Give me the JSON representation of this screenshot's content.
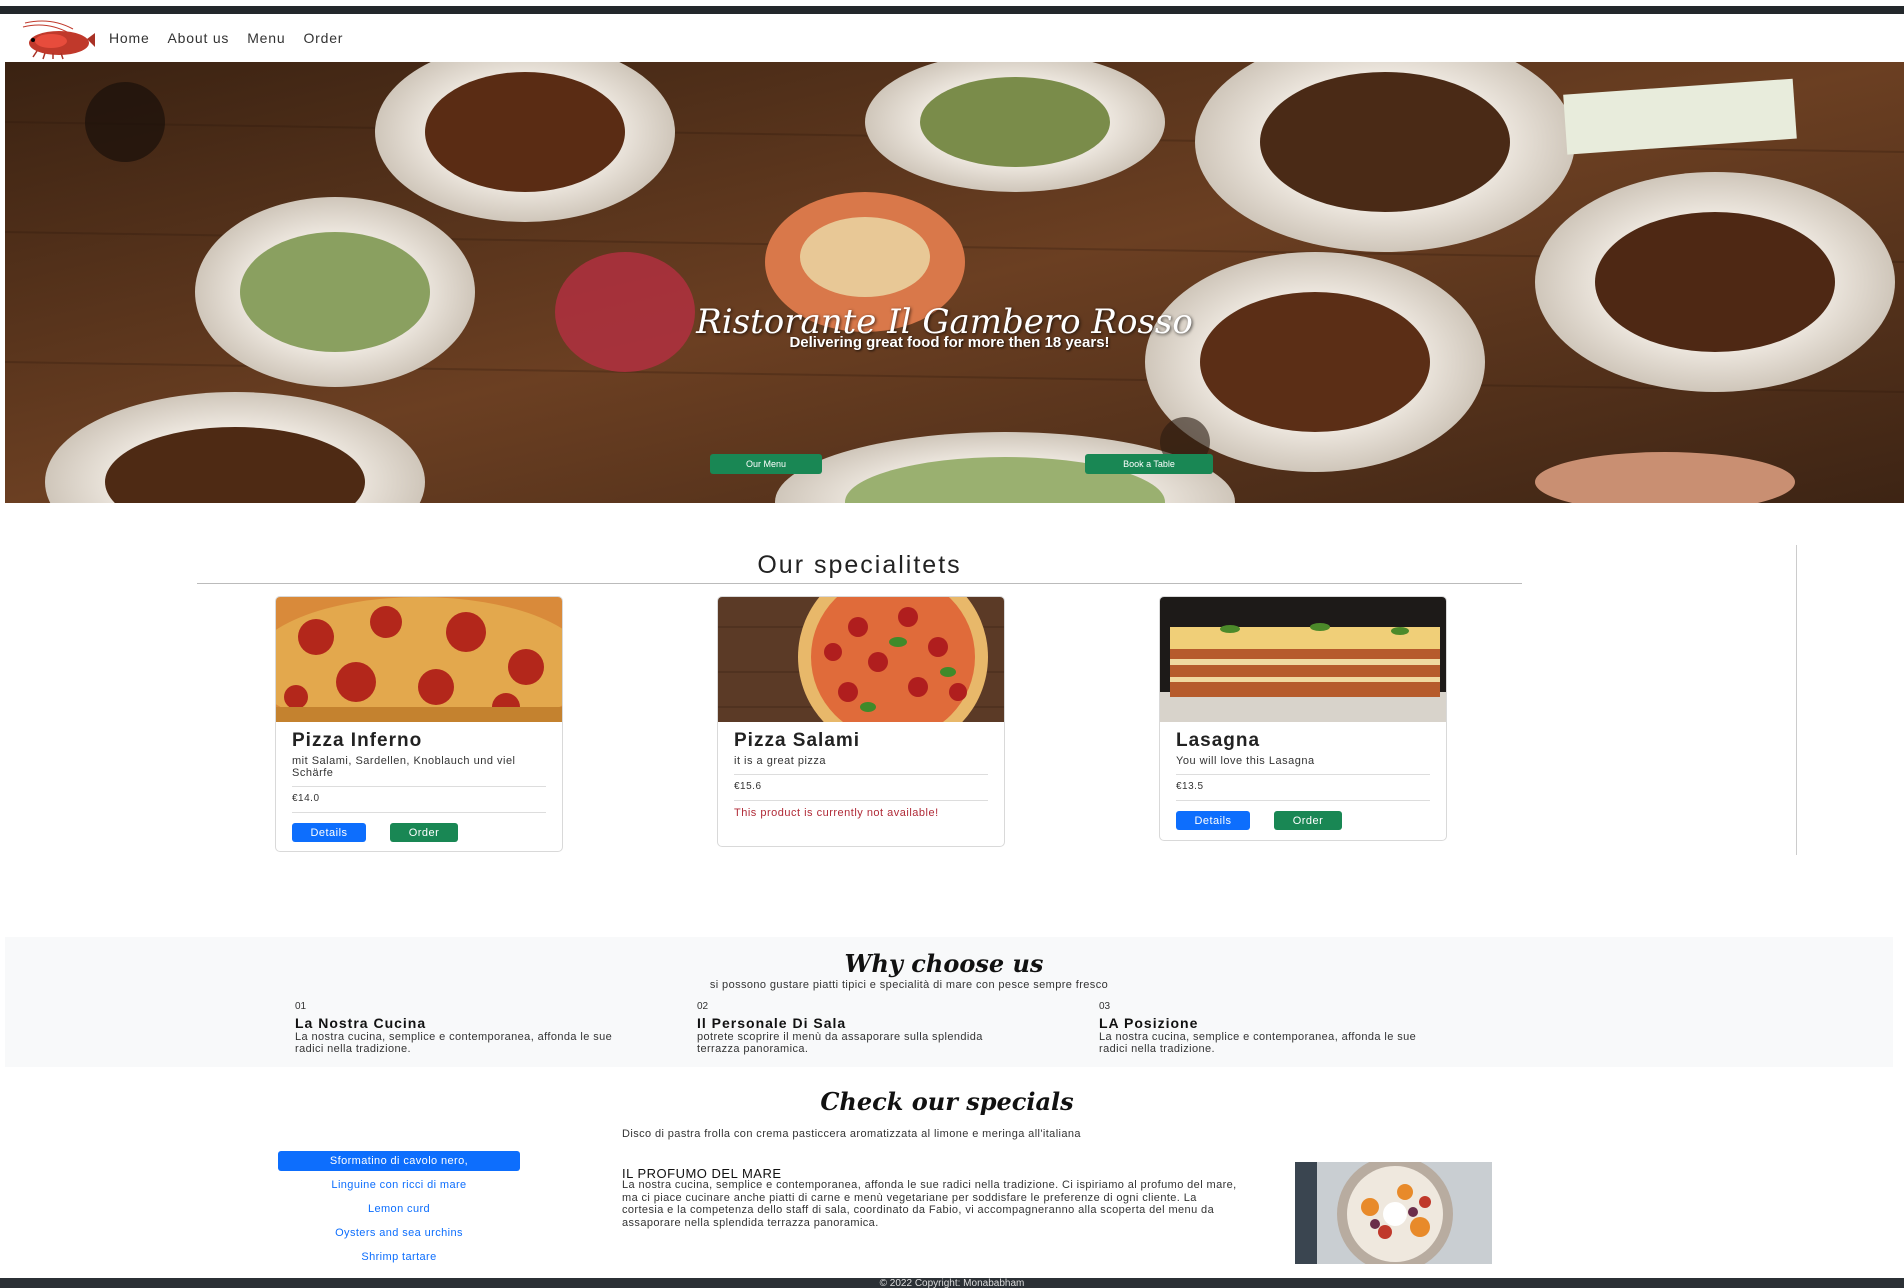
{
  "nav": {
    "logo": "shrimp-logo",
    "links": [
      "Home",
      "About us",
      "Menu",
      "Order"
    ]
  },
  "hero": {
    "title": "Ristorante Il Gambero Rosso",
    "subtitle": "Delivering great food for more then 18 years!",
    "menu_button": "Our Menu",
    "book_button": "Book a Table"
  },
  "specialities": {
    "title": "Our specialitets",
    "cards": [
      {
        "name": "Pizza Inferno",
        "description": "mit Salami, Sardellen, Knoblauch und viel Schärfe",
        "price": "€14.0",
        "details": "Details",
        "order": "Order"
      },
      {
        "name": "Pizza Salami",
        "description": "it is a great pizza",
        "price": "€15.6",
        "unavailable": "This product is currently not available!"
      },
      {
        "name": "Lasagna",
        "description": "You will love this Lasagna",
        "price": "€13.5",
        "details": "Details",
        "order": "Order"
      }
    ]
  },
  "why": {
    "title": "Why choose us",
    "subtitle": "si possono gustare piatti tipici e specialità di mare con pesce sempre fresco",
    "items": [
      {
        "num": "01",
        "heading": "La Nostra Cucina",
        "text": "La nostra cucina, semplice e contemporanea, affonda le sue radici nella tradizione."
      },
      {
        "num": "02",
        "heading": "Il Personale Di Sala",
        "text": "potrete scoprire il menù da assaporare sulla splendida terrazza panoramica."
      },
      {
        "num": "03",
        "heading": "LA Posizione",
        "text": "La nostra cucina, semplice e contemporanea, affonda le sue radici nella tradizione."
      }
    ]
  },
  "specials": {
    "title": "Check our specials",
    "subtitle": "Disco di pastra frolla con crema pasticcera aromatizzata al limone e meringa all'italiana",
    "tabs": [
      "Sformatino di cavolo nero,",
      "Linguine con ricci di mare",
      "Lemon curd",
      "Oysters and sea urchins",
      "Shrimp tartare"
    ],
    "active_tab": 0,
    "detail_heading": "IL PROFUMO DEL MARE",
    "detail_text": "La nostra cucina, semplice e contemporanea, affonda le sue radici nella tradizione. Ci ispiriamo al profumo del mare, ma ci piace cucinare anche piatti di carne e menù vegetariane per soddisfare le preferenze di ogni cliente. La cortesia e la competenza dello staff di sala, coordinato da Fabio, vi accompagneranno alla scoperta del menu da assaporare nella splendida terrazza panoramica."
  },
  "footer": {
    "text": "© 2022 Copyright: Monababham"
  },
  "colors": {
    "primary": "#0d6efd",
    "success": "#198754",
    "danger": "#b02a37",
    "dark": "#23272b"
  }
}
